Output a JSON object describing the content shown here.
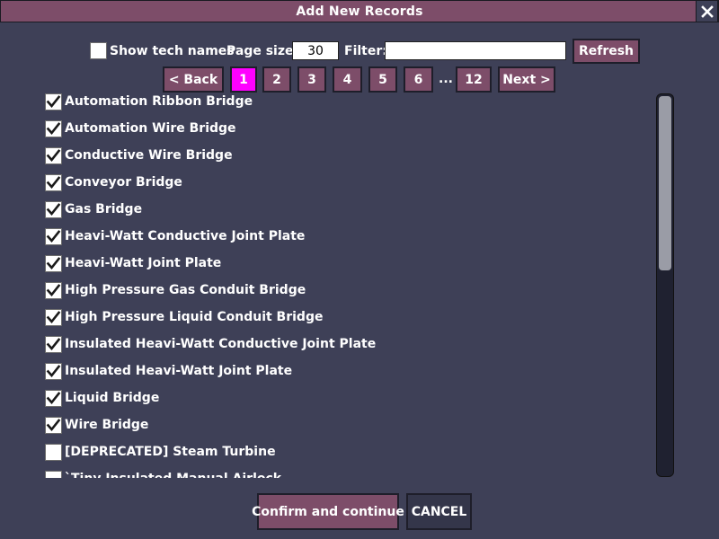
{
  "window": {
    "title": "Add New Records",
    "close_symbol": "✕"
  },
  "toolbar": {
    "show_tech_names_label": "Show tech names",
    "show_tech_names_checked": false,
    "page_size_label": "Page size:",
    "page_size_value": "30",
    "filter_label": "Filter:",
    "filter_value": "",
    "refresh_label": "Refresh"
  },
  "pagination": {
    "back_label": "< Back",
    "next_label": "Next >",
    "pages": [
      "1",
      "2",
      "3",
      "4",
      "5",
      "6",
      "12"
    ],
    "current_page": "1",
    "ellipsis": "..."
  },
  "records": [
    {
      "label": "Automation Ribbon Bridge",
      "checked": true
    },
    {
      "label": "Automation Wire Bridge",
      "checked": true
    },
    {
      "label": "Conductive Wire Bridge",
      "checked": true
    },
    {
      "label": "Conveyor Bridge",
      "checked": true
    },
    {
      "label": "Gas Bridge",
      "checked": true
    },
    {
      "label": "Heavi-Watt Conductive Joint Plate",
      "checked": true
    },
    {
      "label": "Heavi-Watt Joint Plate",
      "checked": true
    },
    {
      "label": "High Pressure Gas Conduit Bridge",
      "checked": true
    },
    {
      "label": "High Pressure Liquid Conduit Bridge",
      "checked": true
    },
    {
      "label": "Insulated Heavi-Watt Conductive Joint Plate",
      "checked": true
    },
    {
      "label": "Insulated Heavi-Watt Joint Plate",
      "checked": true
    },
    {
      "label": "Liquid Bridge",
      "checked": true
    },
    {
      "label": "Wire Bridge",
      "checked": true
    },
    {
      "label": "[DEPRECATED] Steam Turbine",
      "checked": false
    },
    {
      "label": "`Tiny Insulated Manual Airlock",
      "checked": false
    }
  ],
  "scrollbar": {
    "position_fraction": 0.0,
    "visible_fraction": 0.46
  },
  "footer": {
    "confirm_label": "Confirm and continue",
    "cancel_label": "CANCEL"
  },
  "colors": {
    "background": "#3e4057",
    "accent": "#7d4d69",
    "active_page": "#ff00ff",
    "text": "#ffffff"
  }
}
